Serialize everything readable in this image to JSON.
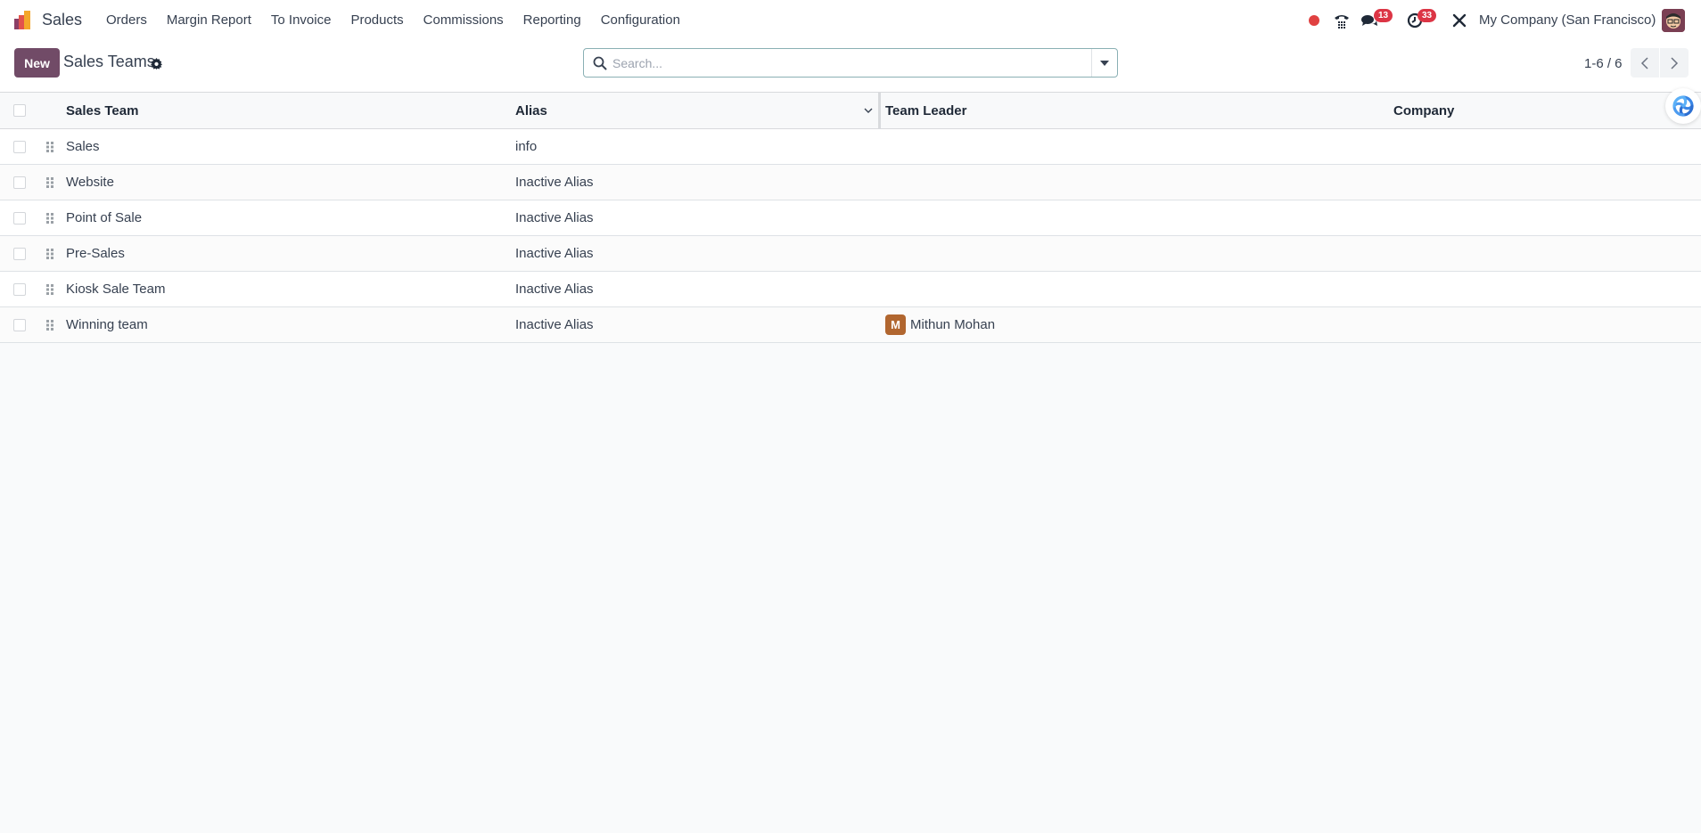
{
  "navbar": {
    "app_name": "Sales",
    "menu": [
      "Orders",
      "Margin Report",
      "To Invoice",
      "Products",
      "Commissions",
      "Reporting",
      "Configuration"
    ],
    "recording_indicator_color": "#e04141",
    "icons": [
      "phone-icon",
      "chat-icon",
      "activity-clock-icon",
      "debug-tools-icon"
    ],
    "messages_badge": "13",
    "activities_badge": "33",
    "company": "My Company (San Francisco)"
  },
  "control_panel": {
    "new_label": "New",
    "breadcrumb": "Sales Teams",
    "search_placeholder": "Search...",
    "search_value": "",
    "pager": "1-6 / 6"
  },
  "table": {
    "columns": [
      "Sales Team",
      "Alias",
      "Team Leader",
      "Company"
    ],
    "rows": [
      {
        "name": "Sales",
        "alias": "info",
        "leader": "",
        "leader_initial": "",
        "company": ""
      },
      {
        "name": "Website",
        "alias": "Inactive Alias",
        "leader": "",
        "leader_initial": "",
        "company": ""
      },
      {
        "name": "Point of Sale",
        "alias": "Inactive Alias",
        "leader": "",
        "leader_initial": "",
        "company": ""
      },
      {
        "name": "Pre-Sales",
        "alias": "Inactive Alias",
        "leader": "",
        "leader_initial": "",
        "company": ""
      },
      {
        "name": "Kiosk Sale Team",
        "alias": "Inactive Alias",
        "leader": "",
        "leader_initial": "",
        "company": ""
      },
      {
        "name": "Winning team",
        "alias": "Inactive Alias",
        "leader": "Mithun Mohan",
        "leader_initial": "M",
        "company": ""
      }
    ]
  },
  "colors": {
    "brand": "#714b67",
    "badge": "#dc3545",
    "leader_avatar": "#b1662f",
    "background": "#f9fafb"
  }
}
